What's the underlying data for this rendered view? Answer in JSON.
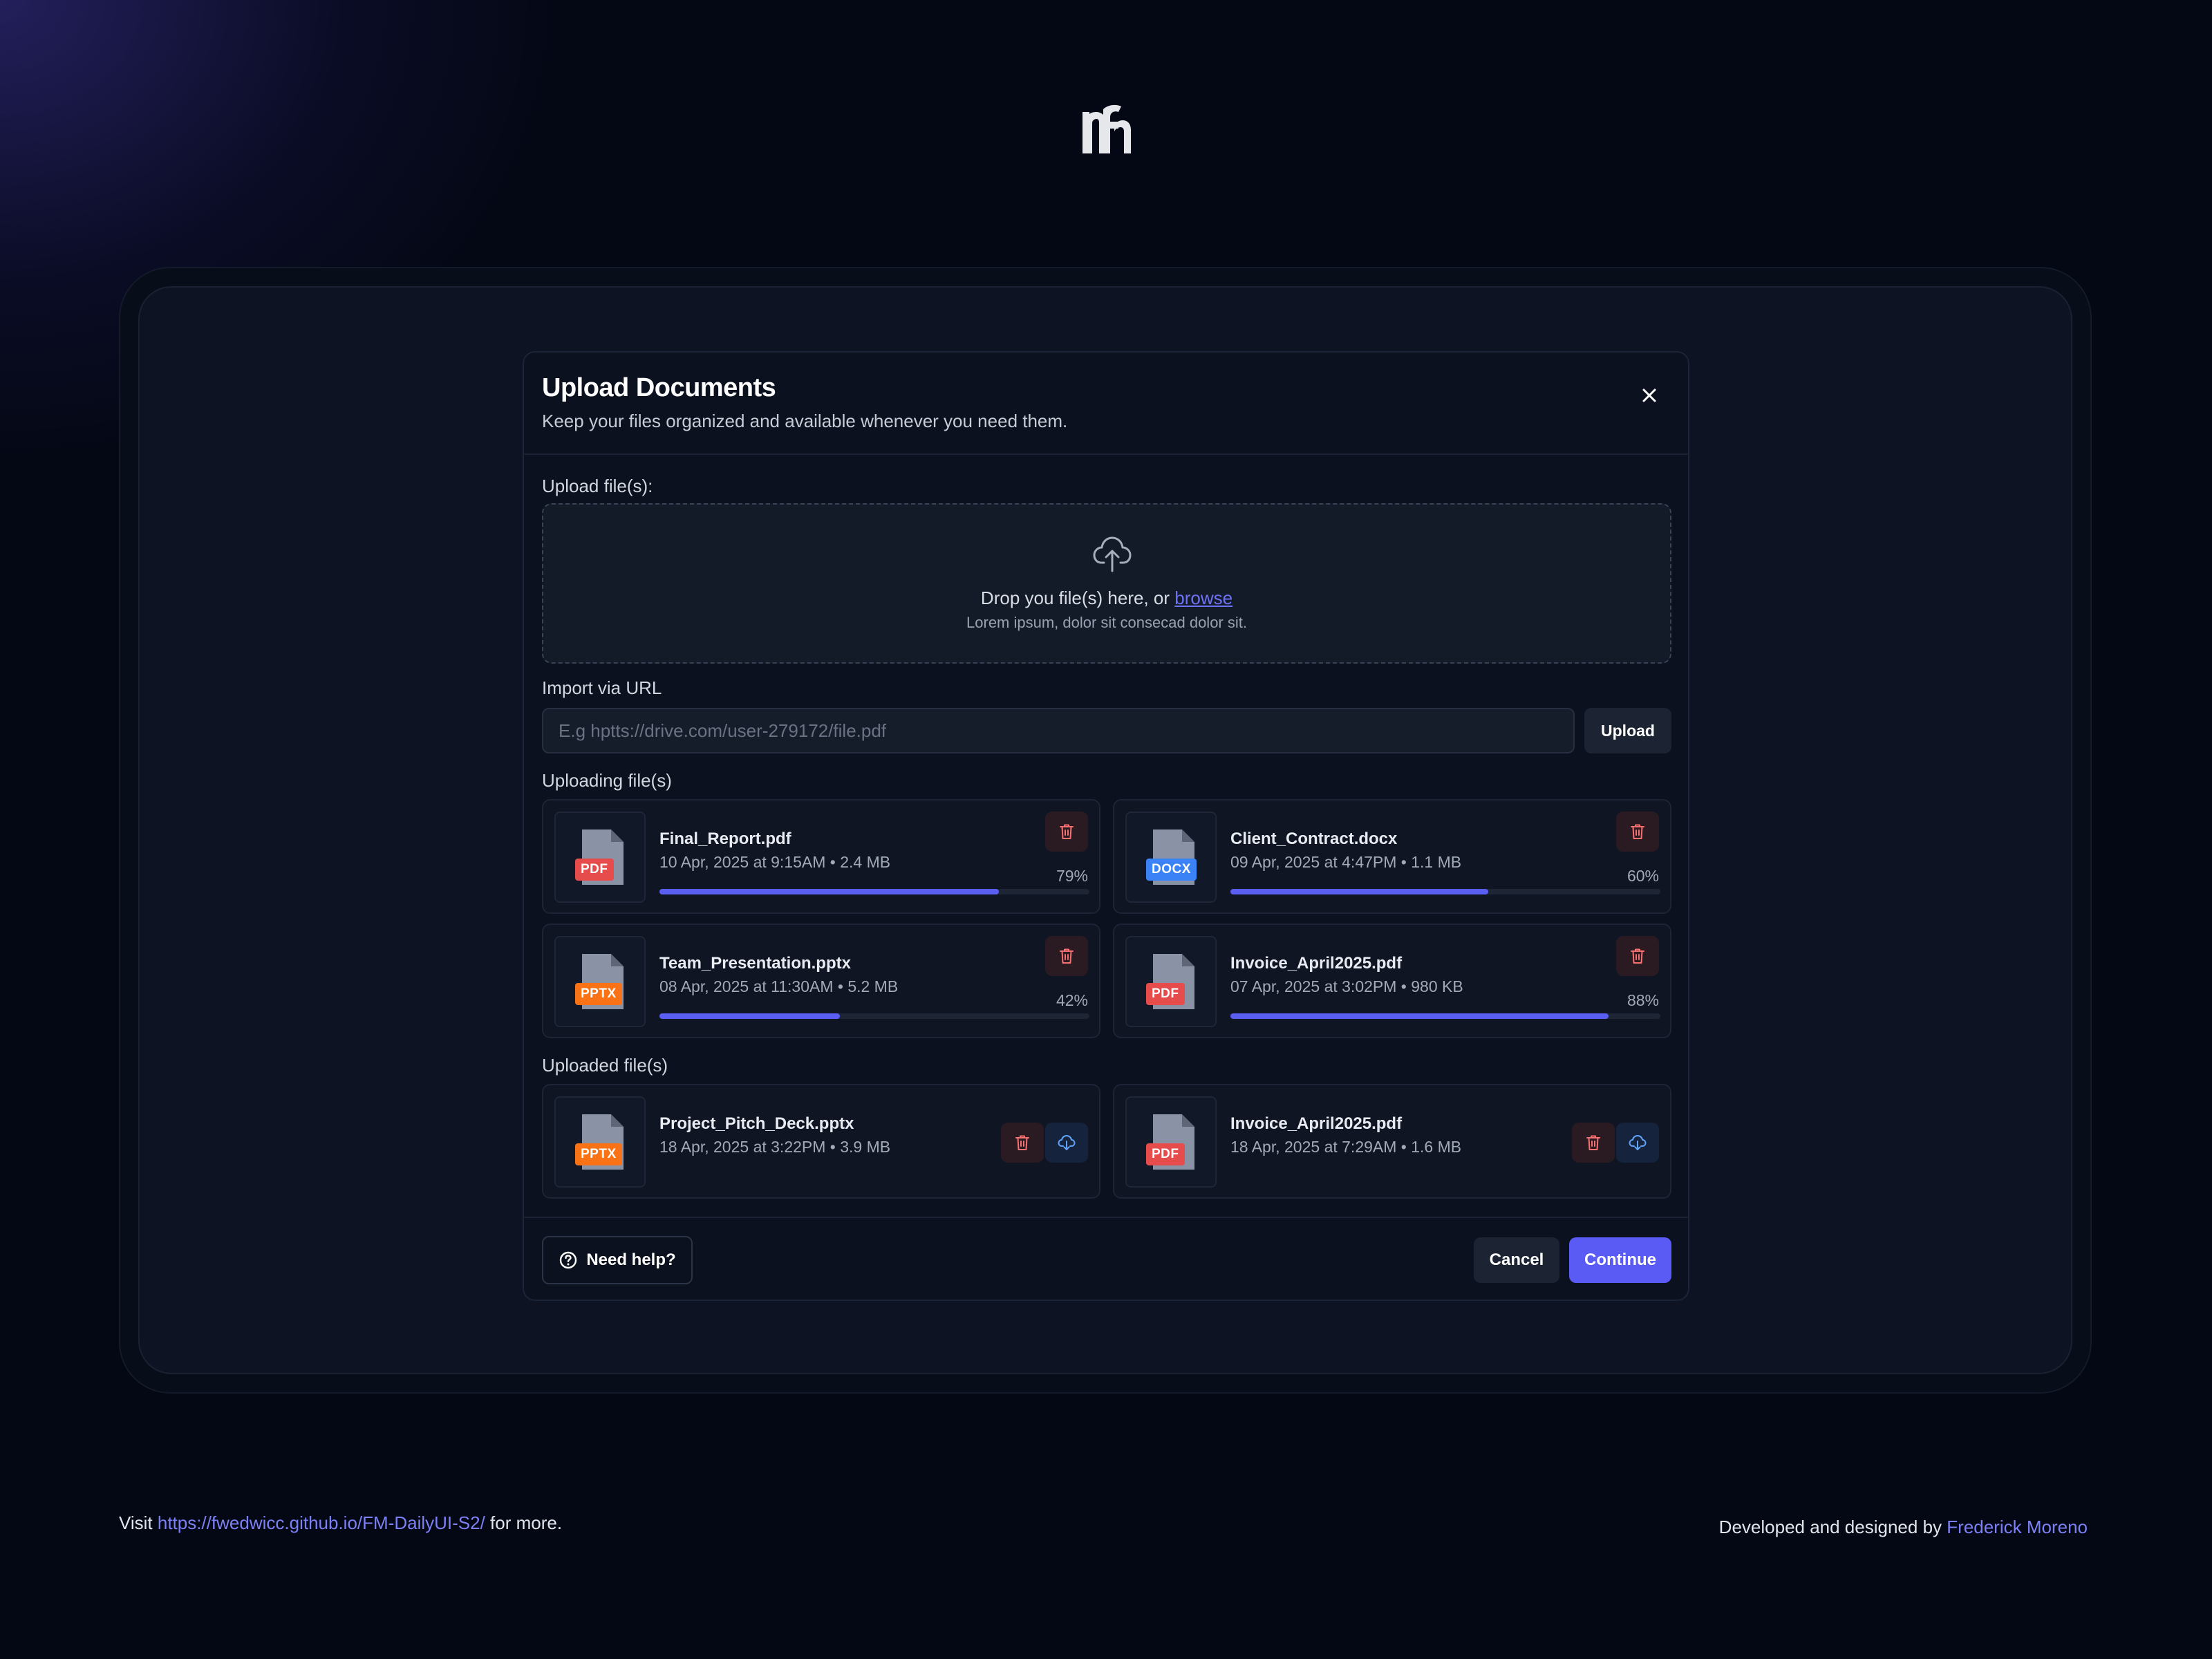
{
  "colors": {
    "accent": "#5a5bf5",
    "link": "#7c80f5",
    "pdf_tag": "#e74c4c",
    "docx_tag": "#3b82f6",
    "pptx_tag": "#f97316",
    "delete": "#f87171",
    "download": "#60a5fa"
  },
  "logo": {
    "icon": "brand-logo-icon"
  },
  "modal": {
    "title": "Upload Documents",
    "subtitle": "Keep your files organized and available whenever you need them.",
    "close_icon": "close-icon"
  },
  "upload": {
    "label": "Upload file(s):",
    "drop_text": "Drop you file(s) here, or ",
    "browse_label": "browse",
    "hint": "Lorem ipsum, dolor sit consecad dolor sit.",
    "icon": "cloud-upload-icon"
  },
  "url_import": {
    "label": "Import via URL",
    "placeholder": "E.g hptts://drive.com/user-279172/file.pdf",
    "value": "",
    "button_label": "Upload"
  },
  "uploading": {
    "label": "Uploading file(s)",
    "files": [
      {
        "name": "Final_Report.pdf",
        "meta": "10 Apr, 2025 at 9:15AM • 2.4 MB",
        "type": "PDF",
        "progress": 79,
        "progress_label": "79%"
      },
      {
        "name": "Client_Contract.docx",
        "meta": "09 Apr, 2025 at 4:47PM • 1.1 MB",
        "type": "DOCX",
        "progress": 60,
        "progress_label": "60%"
      },
      {
        "name": "Team_Presentation.pptx",
        "meta": "08 Apr, 2025 at 11:30AM • 5.2 MB",
        "type": "PPTX",
        "progress": 42,
        "progress_label": "42%"
      },
      {
        "name": "Invoice_April2025.pdf",
        "meta": "07 Apr, 2025 at 3:02PM • 980 KB",
        "type": "PDF",
        "progress": 88,
        "progress_label": "88%"
      }
    ]
  },
  "uploaded": {
    "label": "Uploaded file(s)",
    "files": [
      {
        "name": "Project_Pitch_Deck.pptx",
        "meta": "18 Apr, 2025 at 3:22PM • 3.9 MB",
        "type": "PPTX"
      },
      {
        "name": "Invoice_April2025.pdf",
        "meta": "18 Apr, 2025 at 7:29AM • 1.6 MB",
        "type": "PDF"
      }
    ]
  },
  "footer": {
    "help_label": "Need help?",
    "cancel_label": "Cancel",
    "continue_label": "Continue"
  },
  "page_footer": {
    "visit_prefix": "Visit ",
    "visit_link": "https://fwedwicc.github.io/FM-DailyUI-S2/",
    "visit_suffix": " for more.",
    "credit_prefix": "Developed and designed by ",
    "credit_name": "Frederick Moreno"
  }
}
